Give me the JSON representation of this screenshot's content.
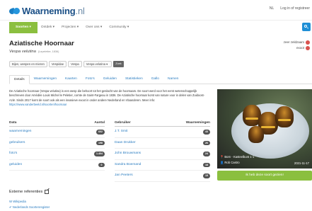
{
  "brand": {
    "name": "Waarneming",
    "tld": ".nl"
  },
  "top_links": [
    "NL",
    "Log in of registreer"
  ],
  "nav": {
    "items": [
      "Soorten ▾",
      "Ontdek ▾",
      "Projecten ▾",
      "Over ons ▾",
      "Community ▾"
    ],
    "active_color": "#8bbf3f"
  },
  "species": {
    "title": "Aziatische Hoornaar",
    "scientific": "Vespa velutina",
    "author": "(Lepeletier, 1836)"
  },
  "status": [
    "zeer zeldzaam",
    "exoot"
  ],
  "breadcrumb": [
    "Bijen, wespen en mieren",
    "Vespidae",
    "Vespa",
    "Vespa velutina ▾"
  ],
  "breadcrumb_button": "Zoek",
  "tabs": [
    "Details",
    "Waarnemingen",
    "Kaarten",
    "Foto's",
    "Geluiden",
    "Statistieken",
    "Gallo",
    "Namen"
  ],
  "description": {
    "text": "De Aziatische hoornaar (Vespa velutina) is een wesp die behoort tot het geslacht van de hoornaars. De soort werd voor het eerst wetenschappelijk beschreven door Amédée Louis Michel le Peletier, comte de Saint-Fargeau in 1836. De Aziatische hoornaar komt van nature voor in delen van Zuidoost-Azië. Sinds 2017 komt de soort ook als een invasieve exoot in onder andere Nederland en Vlaanderen. Meer info:",
    "link": "https://www.vanderbeeld.nl/soorten/hoornaar"
  },
  "data_table": {
    "headers": [
      "Data",
      "Aantal"
    ],
    "rows": [
      {
        "label": "waarnemingen",
        "value": "602"
      },
      {
        "label": "gebruikers",
        "value": "198"
      },
      {
        "label": "foto's",
        "value": "1.404"
      },
      {
        "label": "geluiden",
        "value": "0"
      }
    ]
  },
  "user_table": {
    "headers": [
      "Gebruiker",
      "Waarnemingen"
    ],
    "rows": [
      {
        "label": "J.T. Smit",
        "value": "43"
      },
      {
        "label": "Daan Drukker",
        "value": "26"
      },
      {
        "label": "John Brouwmans",
        "value": "24"
      },
      {
        "label": "Sandra Boemand",
        "value": "18"
      },
      {
        "label": "Jan Peeters",
        "value": "15"
      }
    ]
  },
  "photo": {
    "caption_location": "Born - Kasteelbunt 1-1",
    "caption_user": "Rob Castro",
    "caption_date": "2021-11-17"
  },
  "sighting_button": "Ik heb deze soort gezien!",
  "external": {
    "heading": "Externe referenties",
    "links": [
      "W Wikipedia",
      "Nederlands Soortenregister"
    ]
  }
}
